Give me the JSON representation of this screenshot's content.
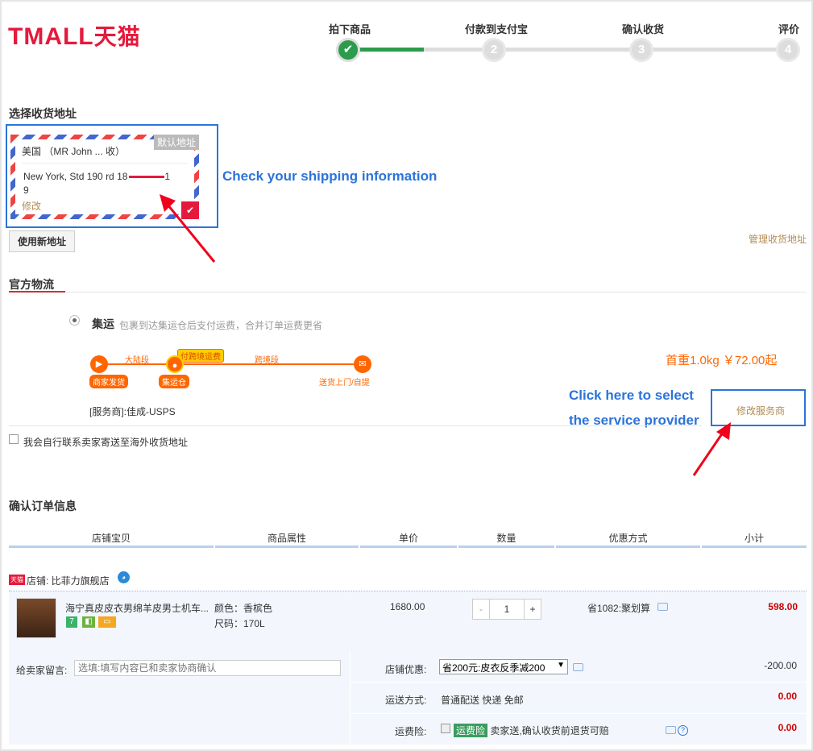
{
  "header": {
    "logo_latin": "TMALL",
    "logo_cn": "天猫",
    "steps": [
      {
        "label": "拍下商品",
        "num": "✔",
        "done": true
      },
      {
        "label": "付款到支付宝",
        "num": "2"
      },
      {
        "label": "确认收货",
        "num": "3"
      },
      {
        "label": "评价",
        "num": "4"
      }
    ]
  },
  "address": {
    "section_title": "选择收货地址",
    "default_badge": "默认地址",
    "line1": "美国 （MR John ... 收）",
    "line2a": "New York, Std 190 rd 18",
    "line2b": "1",
    "line2c": "9",
    "edit_label": "修改",
    "new_address_button": "使用新地址",
    "manage_link": "管理收货地址",
    "annotation": "Check your shipping information"
  },
  "logistics": {
    "section_title": "官方物流",
    "option_name": "集运",
    "option_desc": "包裹到达集运仓后支付运费，合并订单运费更省",
    "route": {
      "seg1": "大陆段",
      "seg2": "跨境段",
      "pay_tag": "付跨境运费",
      "node1": "商家发货",
      "node2": "集运仓",
      "node3": "送货上门/自提"
    },
    "price_from": "首重1.0kg ￥72.00起",
    "provider": "[服务商]:佳成-USPS",
    "annotation_line1": "Click here to select",
    "annotation_line2": "the service provider",
    "change_provider": "修改服务商",
    "self_ship": "我会自行联系卖家寄送至海外收货地址"
  },
  "order": {
    "section_title": "确认订单信息",
    "columns": [
      "店铺宝贝",
      "商品属性",
      "单价",
      "数量",
      "优惠方式",
      "小计"
    ],
    "shop_badge": "天猫",
    "shop_name": "店铺: 比菲力旗舰店",
    "item": {
      "title": "海宁真皮皮衣男绵羊皮男士机车...",
      "tag1": "7",
      "attr_color": "颜色：香槟色",
      "attr_size": "尺码：170L",
      "unit_price": "1680.00",
      "qty_minus": "-",
      "qty": "1",
      "qty_plus": "+",
      "promo": "省1082:聚划算",
      "subtotal": "598.00"
    },
    "message_label": "给卖家留言:",
    "message_placeholder": "选填:填写内容已和卖家协商确认",
    "discount_label": "店铺优惠:",
    "discount_selected": "省200元:皮衣反季减200",
    "discount_amount": "-200.00",
    "delivery_label": "运送方式:",
    "delivery_value": "普通配送 快递 免邮",
    "delivery_amount": "0.00",
    "insurance_label": "运费险:",
    "insurance_badge": "运费险",
    "insurance_value": "卖家送,确认收货前退货可赔",
    "insurance_amount": "0.00"
  },
  "colors": {
    "brand": "#e5193c",
    "annotation": "#2b74d9",
    "link": "#b18c57",
    "route": "#ff6600"
  }
}
